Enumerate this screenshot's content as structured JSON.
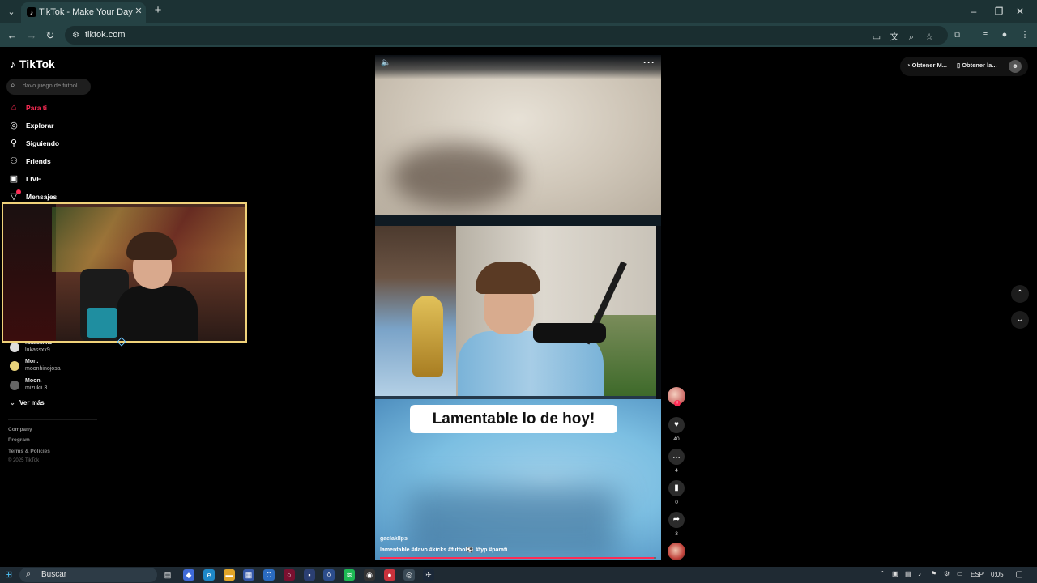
{
  "browser": {
    "tab_title": "TikTok - Make Your Day",
    "url": "tiktok.com"
  },
  "tiktok": {
    "logo_text": "TikTok",
    "search_placeholder": "davo juego de futbol",
    "nav": [
      {
        "label": "Para ti",
        "icon": "home-icon"
      },
      {
        "label": "Explorar",
        "icon": "compass-icon"
      },
      {
        "label": "Siguiendo",
        "icon": "following-icon"
      },
      {
        "label": "Friends",
        "icon": "friends-icon"
      },
      {
        "label": "LIVE",
        "icon": "live-icon"
      },
      {
        "label": "Mensajes",
        "icon": "messages-icon"
      }
    ],
    "following": [
      {
        "name": "lukassxx9",
        "handle": "lukassxx9"
      },
      {
        "name": "Mon.",
        "handle": "moonhinojosa"
      },
      {
        "name": "Moon.",
        "handle": "mizukii.3"
      }
    ],
    "see_more": "Ver más",
    "footer": {
      "company": "Company",
      "program": "Program",
      "terms": "Terms & Policies",
      "copyright": "© 2025 TikTok"
    },
    "top_actions": {
      "app_label": "Obtener M...",
      "desktop_label": "Obtener la..."
    },
    "video": {
      "caption": "Lamentable lo de hoy!",
      "author": "gaelakllps",
      "hashtags": "lamentable #davo #kicks #futbol⚽ #fyp #parati",
      "progress": 0.99
    },
    "actions": {
      "likes": "40",
      "comments": "4",
      "saves": "0",
      "shares": "3"
    }
  },
  "taskbar": {
    "search_label": "Buscar",
    "language": "ESP",
    "time": "0:05"
  }
}
